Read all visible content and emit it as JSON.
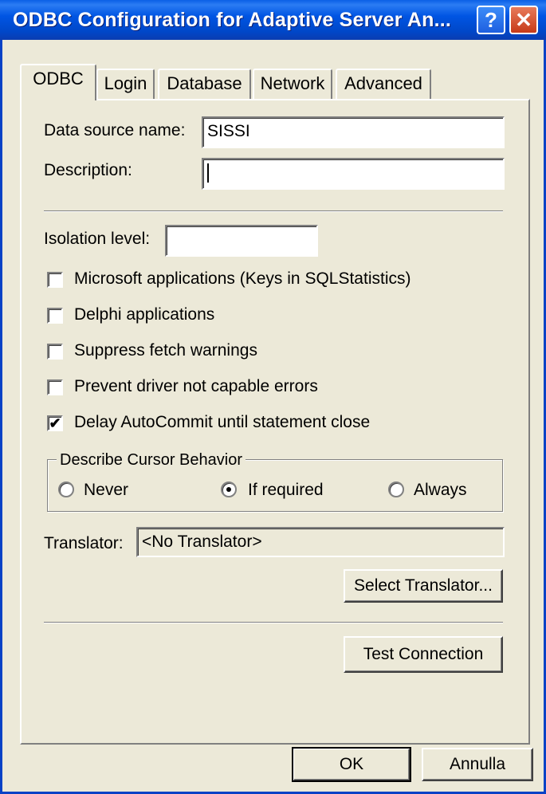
{
  "window": {
    "title": "ODBC Configuration for Adaptive Server An...",
    "help_glyph": "?",
    "close_glyph": "✕"
  },
  "tabs": [
    "ODBC",
    "Login",
    "Database",
    "Network",
    "Advanced"
  ],
  "active_tab": "ODBC",
  "odbc": {
    "data_source_label": "Data source name:",
    "data_source_value": "SISSI",
    "description_label": "Description:",
    "description_value": "",
    "isolation_label": "Isolation level:",
    "isolation_value": "",
    "checkboxes": [
      {
        "label": "Microsoft applications (Keys in SQLStatistics)",
        "checked": false
      },
      {
        "label": "Delphi applications",
        "checked": false
      },
      {
        "label": "Suppress fetch warnings",
        "checked": false
      },
      {
        "label": "Prevent driver not capable errors",
        "checked": false
      },
      {
        "label": "Delay AutoCommit until statement close",
        "checked": true
      }
    ],
    "cursor_group": {
      "label": "Describe Cursor Behavior",
      "options": [
        "Never",
        "If required",
        "Always"
      ],
      "selected": "If required"
    },
    "translator_label": "Translator:",
    "translator_value": "<No Translator>",
    "select_translator_button": "Select Translator...",
    "test_connection_button": "Test Connection"
  },
  "footer": {
    "ok_button": "OK",
    "cancel_button": "Annulla"
  }
}
